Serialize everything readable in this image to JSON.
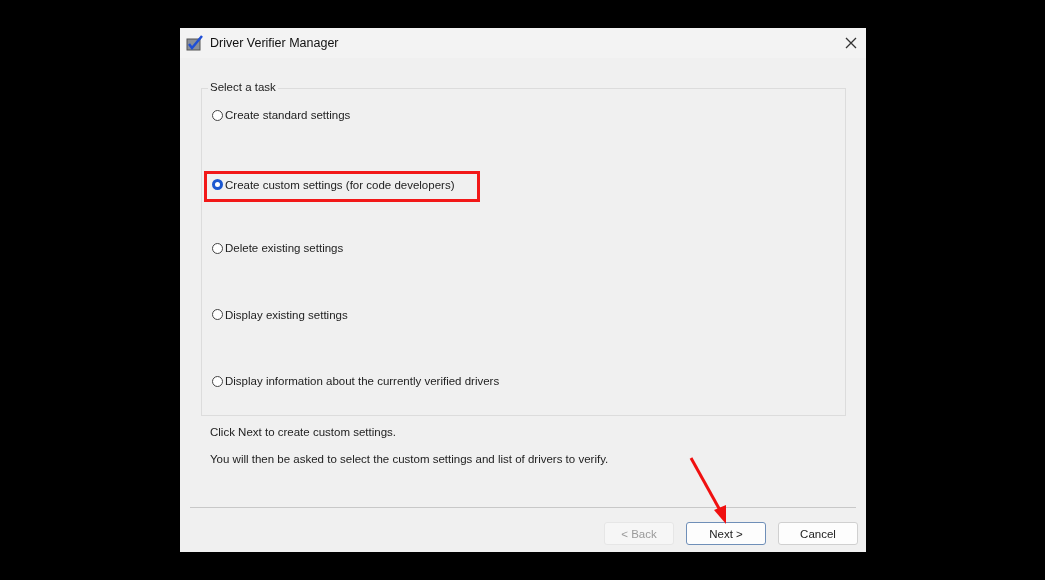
{
  "window": {
    "title": "Driver Verifier Manager"
  },
  "group": {
    "title": "Select a task"
  },
  "options": [
    {
      "label": "Create standard settings",
      "selected": false,
      "highlighted": false
    },
    {
      "label": "Create custom settings (for code developers)",
      "selected": true,
      "highlighted": true
    },
    {
      "label": "Delete existing settings",
      "selected": false,
      "highlighted": false
    },
    {
      "label": "Display existing settings",
      "selected": false,
      "highlighted": false
    },
    {
      "label": "Display information about the currently verified drivers",
      "selected": false,
      "highlighted": false
    }
  ],
  "info": [
    "Click Next to create custom settings.",
    "You will then be asked to select the custom settings and list of drivers to verify."
  ],
  "buttons": [
    {
      "label": "< Back",
      "disabled": true,
      "default": false,
      "pointed": false
    },
    {
      "label": "Next >",
      "disabled": false,
      "default": true,
      "pointed": true
    },
    {
      "label": "Cancel",
      "disabled": false,
      "default": false,
      "pointed": false
    }
  ]
}
